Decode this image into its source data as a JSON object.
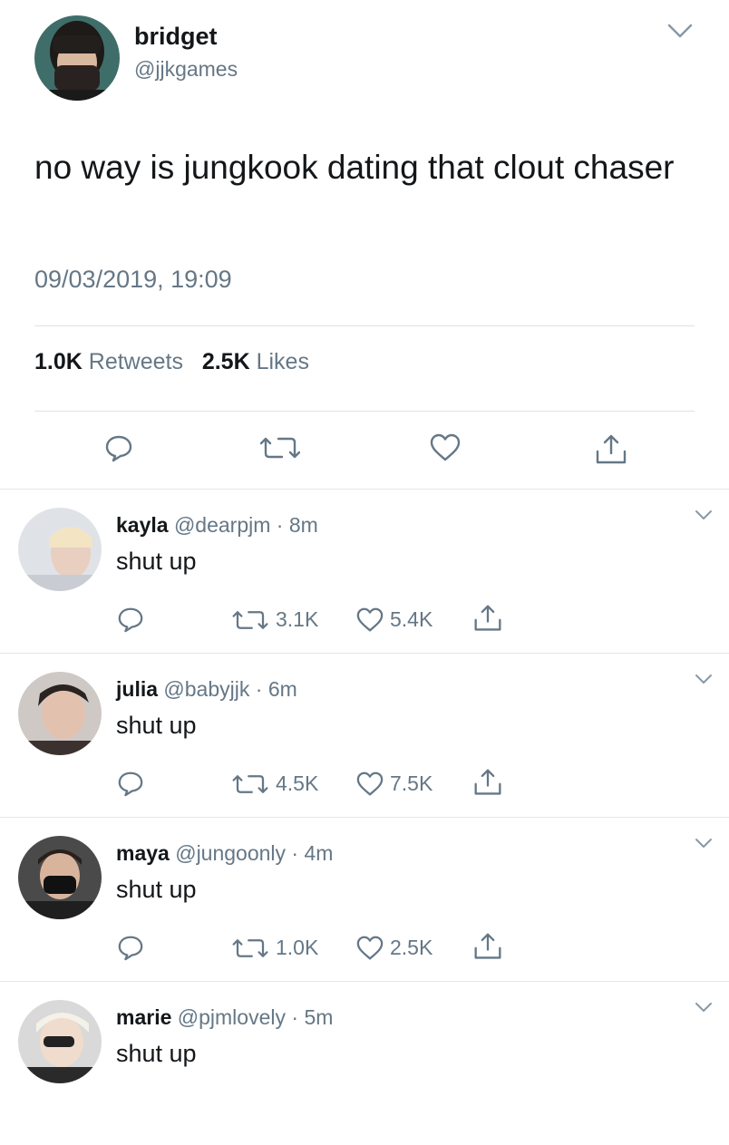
{
  "tweet": {
    "display_name": "bridget",
    "handle": "@jjkgames",
    "text": "no way is jungkook dating that clout chaser",
    "timestamp": "09/03/2019, 19:09",
    "retweets_count": "1.0K",
    "retweets_label": "Retweets",
    "likes_count": "2.5K",
    "likes_label": "Likes"
  },
  "replies": [
    {
      "name": "kayla",
      "handle": "@dearpjm",
      "time": "8m",
      "text": "shut up",
      "retweets": "3.1K",
      "likes": "5.4K"
    },
    {
      "name": "julia",
      "handle": "@babyjjk",
      "time": "6m",
      "text": "shut up",
      "retweets": "4.5K",
      "likes": "7.5K"
    },
    {
      "name": "maya",
      "handle": "@jungoonly",
      "time": "4m",
      "text": "shut up",
      "retweets": "1.0K",
      "likes": "2.5K"
    },
    {
      "name": "marie",
      "handle": "@pjmlovely",
      "time": "5m",
      "text": "shut up"
    }
  ],
  "separator": "·",
  "icons": {
    "reply": "speech-bubble",
    "retweet": "retweet-arrows",
    "like": "heart-outline",
    "share": "upload-arrow",
    "menu": "chevron-down"
  },
  "colors": {
    "text": "#14171a",
    "secondary": "#657786",
    "divider": "#e1e8ed"
  }
}
